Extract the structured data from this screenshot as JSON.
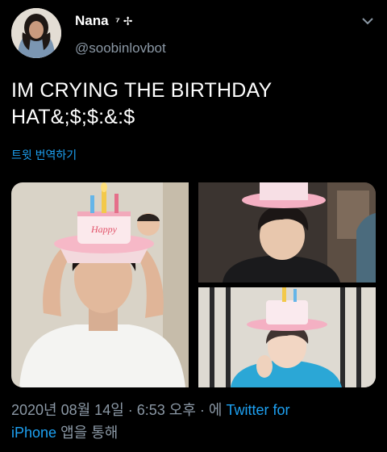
{
  "user": {
    "display_name": "Nana",
    "name_suffix": "⁷ ✢",
    "handle": "@soobinlovbot"
  },
  "tweet": {
    "text_line1": "IM CRYING THE BIRTHDAY",
    "text_line2": "HAT&;$;$:&:$",
    "translate_label": "트윗 번역하기"
  },
  "media": {
    "hat_text": "Happy"
  },
  "footer": {
    "timestamp": "2020년 08월 14일 · 6:53 오후 · 에",
    "source_link": "Twitter for iPhone",
    "source_link_line1": "Twitter for",
    "source_link_line2": "iPhone",
    "source_suffix": "앱을 통해"
  }
}
